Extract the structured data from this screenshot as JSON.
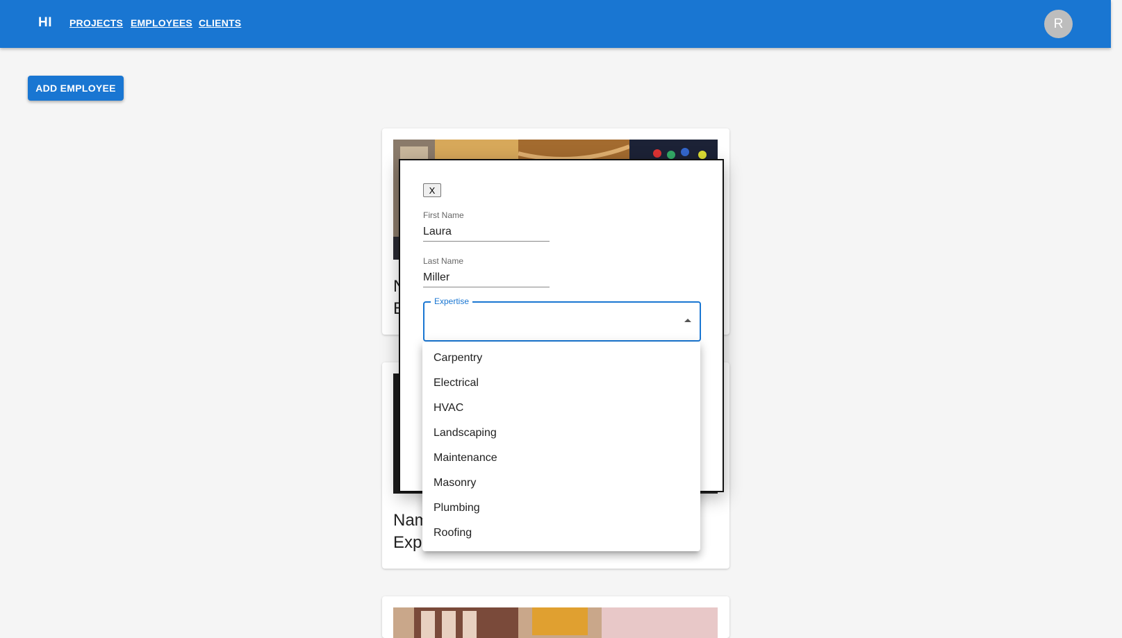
{
  "appbar": {
    "brand": "HI",
    "nav": [
      "PROJECTS",
      "EMPLOYEES",
      "CLIENTS"
    ],
    "avatar_initial": "R",
    "color": "#1976d2"
  },
  "actions": {
    "add_employee_label": "ADD EMPLOYEE"
  },
  "cards": [
    {
      "line1": "N",
      "line2": "E"
    },
    {
      "line1": "Nam",
      "line2": "Exp"
    }
  ],
  "modal": {
    "close_label": "X",
    "first_name": {
      "label": "First Name",
      "value": "Laura"
    },
    "last_name": {
      "label": "Last Name",
      "value": "Miller"
    },
    "expertise": {
      "label": "Expertise",
      "value": "",
      "options": [
        "Carpentry",
        "Electrical",
        "HVAC",
        "Landscaping",
        "Maintenance",
        "Masonry",
        "Plumbing",
        "Roofing"
      ]
    }
  }
}
